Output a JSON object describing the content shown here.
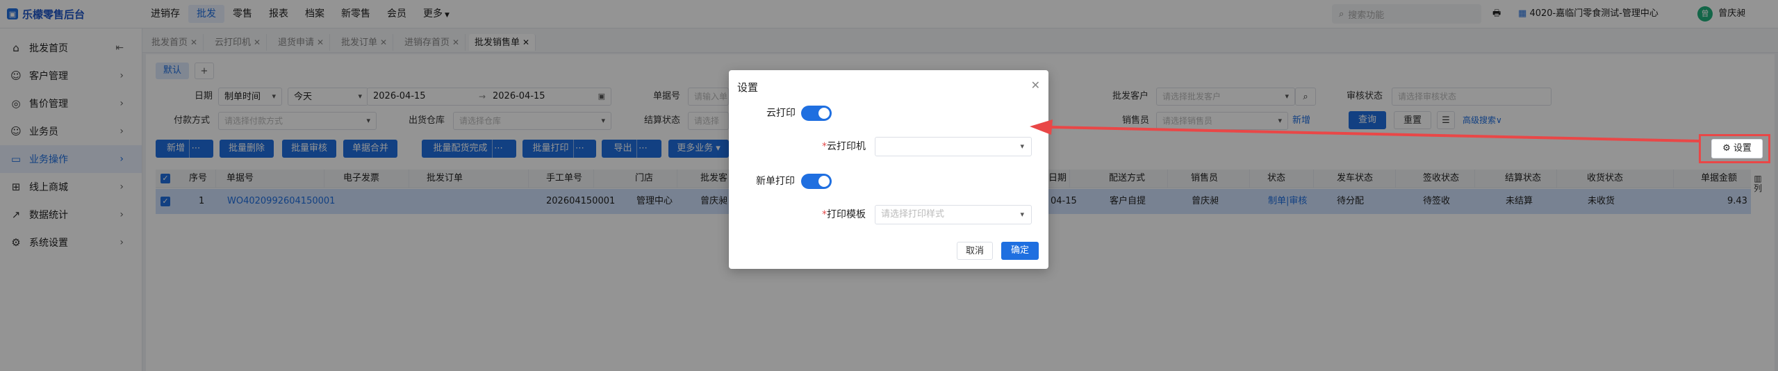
{
  "brand": {
    "name": "乐檬零售后台"
  },
  "topnav": {
    "items": [
      "进销存",
      "批发",
      "零售",
      "报表",
      "档案",
      "新零售",
      "会员",
      "更多"
    ],
    "active_index": 1,
    "search_placeholder": "搜索功能",
    "store": "4020-嘉临门零食测试-管理中心",
    "user": "曾庆昶"
  },
  "sidebar": {
    "collapse_icon": "collapse-icon",
    "items": [
      {
        "label": "批发首页",
        "icon": "home-icon"
      },
      {
        "label": "客户管理",
        "icon": "user-icon"
      },
      {
        "label": "售价管理",
        "icon": "price-icon"
      },
      {
        "label": "业务员",
        "icon": "person-icon"
      },
      {
        "label": "业务操作",
        "icon": "operation-icon"
      },
      {
        "label": "线上商城",
        "icon": "mall-icon"
      },
      {
        "label": "数据统计",
        "icon": "chart-icon"
      },
      {
        "label": "系统设置",
        "icon": "settings-icon"
      }
    ],
    "active_index": 4
  },
  "tabs": [
    "批发首页",
    "云打印机",
    "退货申请",
    "批发订单",
    "进销存首页",
    "批发销售单"
  ],
  "active_tab": 5,
  "views": {
    "default": "默认",
    "add": "+"
  },
  "filters": {
    "date_label": "日期",
    "date_type": "制单时间",
    "date_range": "今天",
    "date_start": "2026-04-15",
    "date_sep": "→",
    "date_end": "2026-04-15",
    "order_no_label": "单据号",
    "order_no_placeholder": "请输入单",
    "customer_label": "批发客户",
    "customer_placeholder": "请选择批发客户",
    "audit_label": "审核状态",
    "audit_placeholder": "请选择审核状态",
    "payment_label": "付款方式",
    "payment_placeholder": "请选择付款方式",
    "warehouse_label": "出货仓库",
    "warehouse_placeholder": "请选择仓库",
    "settle_label": "结算状态",
    "settle_placeholder": "请选择",
    "salesman_label": "销售员",
    "salesman_placeholder": "请选择销售员",
    "new_link": "新增",
    "query": "查询",
    "reset": "重置",
    "advanced": "高级搜索"
  },
  "toolbar": [
    "新增",
    "批量删除",
    "批量审核",
    "单据合并",
    "批量配货完成",
    "批量打印",
    "导出",
    "更多业务"
  ],
  "settings_button": "设置",
  "table": {
    "headers": [
      "序号",
      "单据号",
      "电子发票",
      "批发订单",
      "手工单号",
      "门店",
      "批发客",
      "日期",
      "配送方式",
      "销售员",
      "状态",
      "发车状态",
      "签收状态",
      "结算状态",
      "收货状态",
      "单据金额"
    ],
    "column_setting": "列",
    "rows": [
      {
        "seq": "1",
        "order_no": "WO4020992604150001",
        "manual_no": "202604150001",
        "store": "管理中心",
        "customer": "曾庆昶",
        "date": "04-15",
        "delivery": "客户自提",
        "salesman": "曾庆昶",
        "status": "制单|审核",
        "dispatch": "待分配",
        "sign": "待签收",
        "settle": "未结算",
        "receive": "未收货",
        "amount": "9.43"
      }
    ]
  },
  "modal": {
    "title": "设置",
    "cloud_print_label": "云打印",
    "cloud_printer_label": "云打印机",
    "new_print_label": "新单打印",
    "template_label": "打印模板",
    "template_placeholder": "请选择打印样式",
    "cancel": "取消",
    "confirm": "确定",
    "cloud_print_on": true,
    "new_print_on": true
  },
  "colors": {
    "accent": "#1f6fe0",
    "annotation": "#e94747",
    "row_selected": "#cfe1fb"
  }
}
